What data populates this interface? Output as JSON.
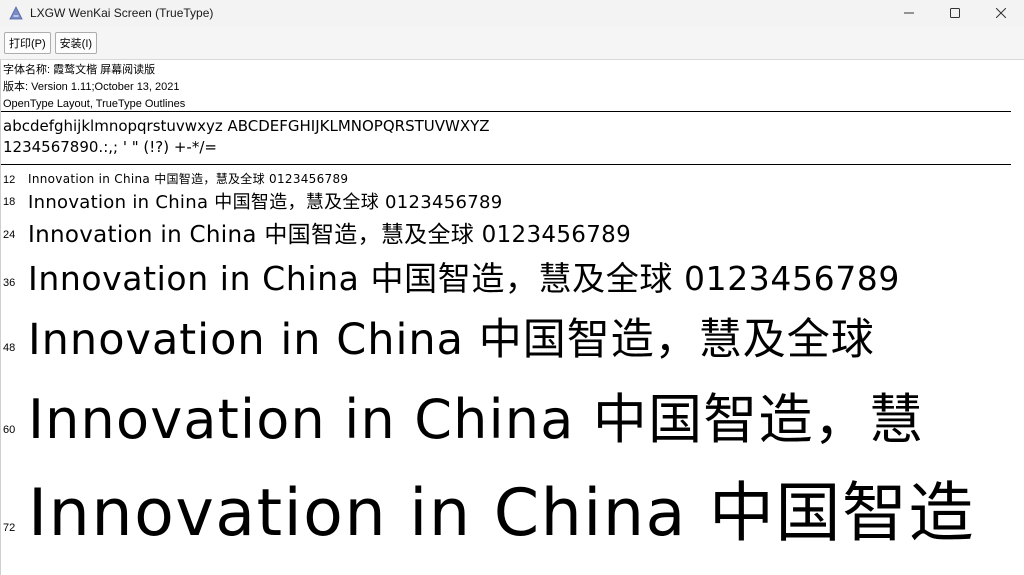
{
  "window": {
    "title": "LXGW WenKai Screen (TrueType)"
  },
  "toolbar": {
    "print_label": "打印(P)",
    "install_label": "安装(I)"
  },
  "info": {
    "font_name_line": "字体名称: 霞鹜文楷 屏幕阅读版",
    "version_line": "版本: Version 1.11;October 13, 2021",
    "format_line": "OpenType Layout, TrueType Outlines"
  },
  "charset": {
    "letters": "abcdefghijklmnopqrstuvwxyz ABCDEFGHIJKLMNOPQRSTUVWXYZ",
    "digits_symbols": "1234567890.:,; ' \" (!?) +-*/="
  },
  "samples": [
    {
      "size_label": "12",
      "text": "Innovation in China 中国智造，慧及全球 0123456789"
    },
    {
      "size_label": "18",
      "text": "Innovation in China 中国智造，慧及全球 0123456789"
    },
    {
      "size_label": "24",
      "text": "Innovation in China 中国智造，慧及全球 0123456789"
    },
    {
      "size_label": "36",
      "text": "Innovation in China 中国智造，慧及全球 0123456789"
    },
    {
      "size_label": "48",
      "text": "Innovation in China 中国智造，慧及全球"
    },
    {
      "size_label": "60",
      "text": "Innovation in China 中国智造，慧"
    },
    {
      "size_label": "72",
      "text": "Innovation in China 中国智造"
    }
  ]
}
